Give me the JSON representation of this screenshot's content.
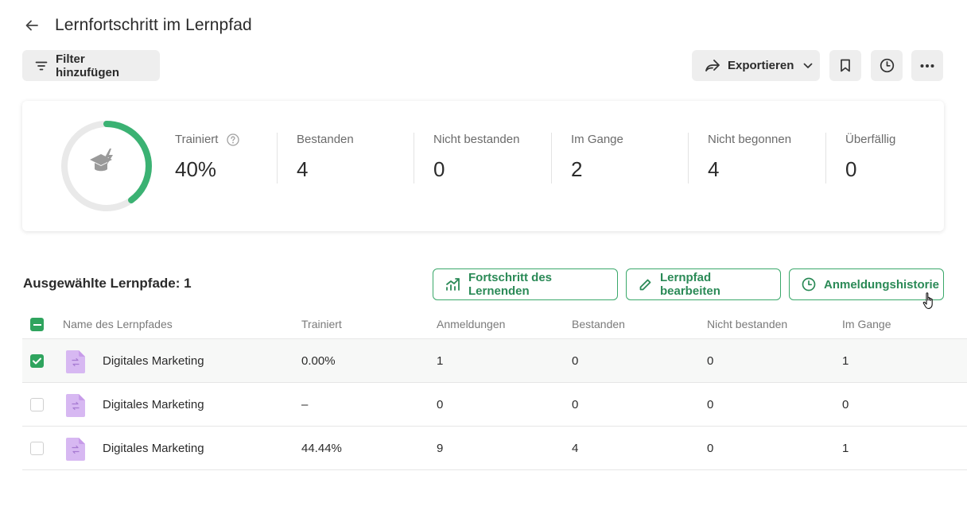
{
  "header": {
    "title": "Lernfortschritt im Lernpfad"
  },
  "toolbar": {
    "filter_label": "Filter hinzufügen",
    "export_label": "Exportieren"
  },
  "stats": {
    "ring_progress": 0.4,
    "ring_color": "#3bb273",
    "items": [
      {
        "label": "Trainiert",
        "value": "40%"
      },
      {
        "label": "Bestanden",
        "value": "4"
      },
      {
        "label": "Nicht bestanden",
        "value": "0"
      },
      {
        "label": "Im Gange",
        "value": "2"
      },
      {
        "label": "Nicht begonnen",
        "value": "4"
      },
      {
        "label": "Überfällig",
        "value": "0"
      }
    ]
  },
  "section": {
    "title": "Ausgewählte Lernpfade: 1",
    "progress_button": "Fortschritt des Lernenden",
    "edit_button": "Lernpfad bearbeiten",
    "history_button": "Anmeldungshistorie"
  },
  "table": {
    "columns": [
      "Name des Lernpfades",
      "Trainiert",
      "Anmeldungen",
      "Bestanden",
      "Nicht bestanden",
      "Im Gange"
    ],
    "rows": [
      {
        "checked": true,
        "name": "Digitales Marketing",
        "trainiert": "0.00%",
        "anmeldungen": "1",
        "bestanden": "0",
        "nicht_bestanden": "0",
        "im_gange": "1"
      },
      {
        "checked": false,
        "name": "Digitales Marketing",
        "trainiert": "–",
        "anmeldungen": "0",
        "bestanden": "0",
        "nicht_bestanden": "0",
        "im_gange": "0"
      },
      {
        "checked": false,
        "name": "Digitales Marketing",
        "trainiert": "44.44%",
        "anmeldungen": "9",
        "bestanden": "4",
        "nicht_bestanden": "0",
        "im_gange": "1"
      }
    ]
  },
  "colors": {
    "accent": "#2fa45e",
    "file_icon": "#d7b8f2"
  }
}
